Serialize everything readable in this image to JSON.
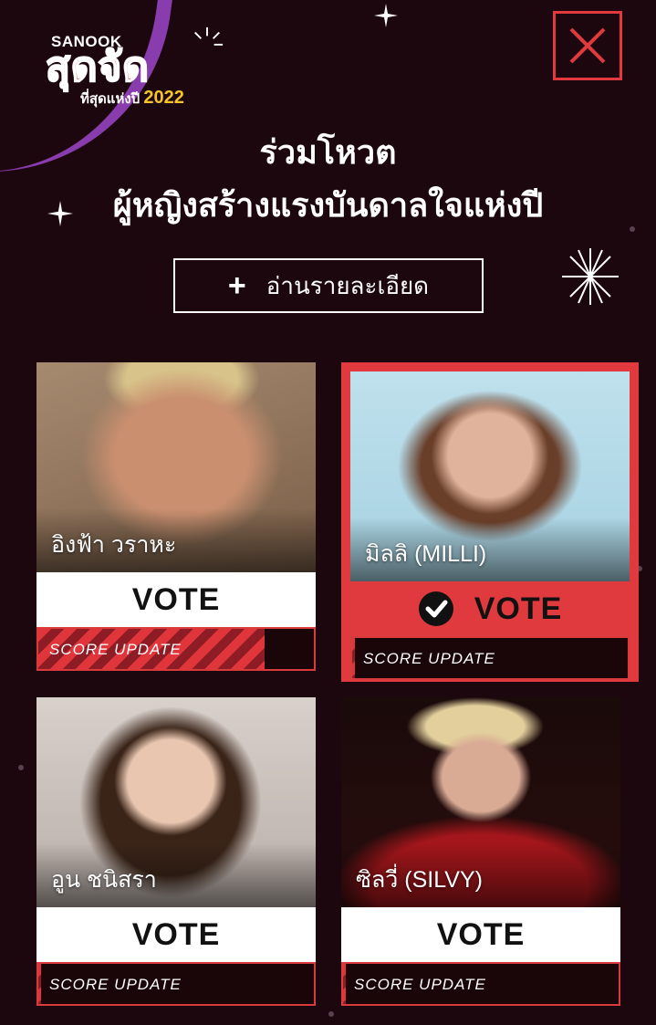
{
  "logo": {
    "brand": "SANOOK",
    "main": "สุดจัด",
    "sub": "ที่สุดแห่งปี",
    "year": "2022"
  },
  "header": {
    "title_line1": "ร่วมโหวต",
    "title_line2": "ผู้หญิงสร้างแรงบันดาลใจแห่งปี",
    "read_more_label": "อ่านรายละเอียด"
  },
  "candidates": [
    {
      "name": "อิงฟ้า วราหะ",
      "vote_label": "VOTE",
      "score_label": "SCORE UPDATE",
      "score_fill": 0.82,
      "selected": false
    },
    {
      "name": "มิลลิ (MILLI)",
      "vote_label": "VOTE",
      "score_label": "SCORE UPDATE",
      "score_fill": 0.01,
      "selected": true
    },
    {
      "name": "อูน ชนิสรา",
      "vote_label": "VOTE",
      "score_label": "SCORE UPDATE",
      "score_fill": 0.01,
      "selected": false
    },
    {
      "name": "ซิลวี่ (SILVY)",
      "vote_label": "VOTE",
      "score_label": "SCORE UPDATE",
      "score_fill": 0.01,
      "selected": false
    }
  ],
  "colors": {
    "background": "#1d070f",
    "accent": "#e03a3e",
    "logo_purple": "#8e3fb6",
    "logo_yellow": "#f6c428"
  }
}
